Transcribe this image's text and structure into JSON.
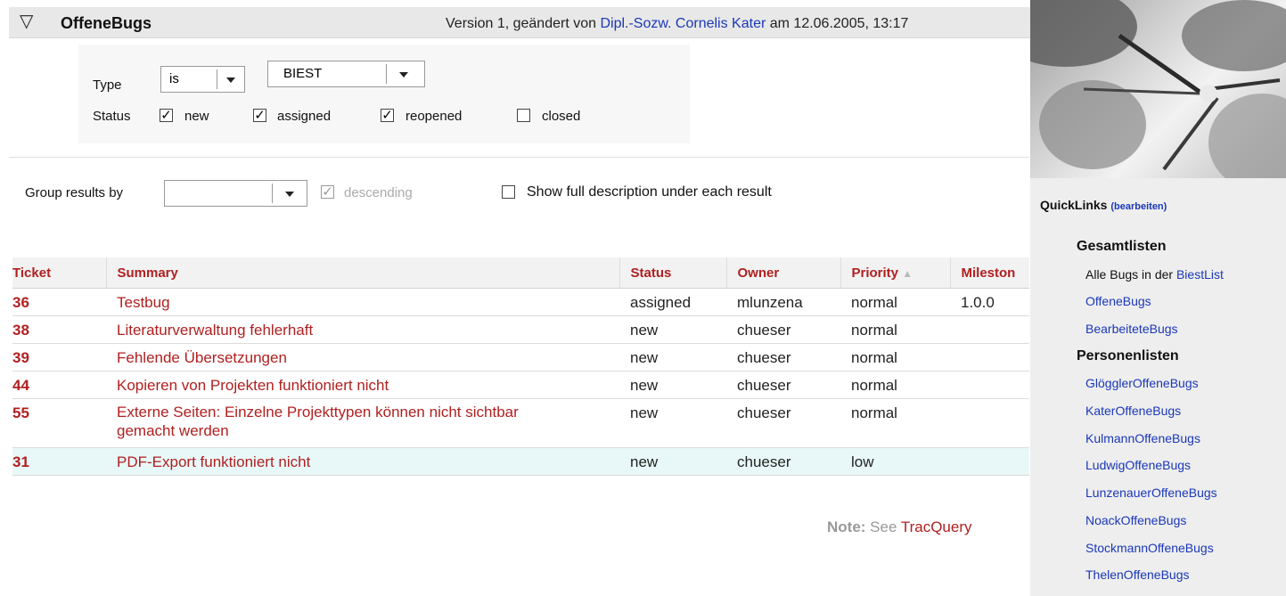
{
  "header": {
    "toggle_icon": "triangle-down",
    "title": "OffeneBugs",
    "version_prefix": "Version 1, geändert von ",
    "version_author": "Dipl.-Sozw. Cornelis Kater",
    "version_suffix": " am 12.06.2005, 13:17"
  },
  "filters": {
    "type_label": "Type",
    "type_operator": "is",
    "type_value": "BIEST",
    "status_label": "Status",
    "status_options": [
      {
        "label": "new",
        "checked": true
      },
      {
        "label": "assigned",
        "checked": true
      },
      {
        "label": "reopened",
        "checked": true
      },
      {
        "label": "closed",
        "checked": false
      }
    ]
  },
  "group": {
    "label": "Group results by",
    "value": "",
    "descending_label": "descending",
    "show_desc_label": "Show full description under each result"
  },
  "table": {
    "columns": [
      "Ticket",
      "Summary",
      "Status",
      "Owner",
      "Priority",
      "Mileston"
    ],
    "sort_indicator": "▲",
    "rows": [
      {
        "id": "36",
        "summary": "Testbug",
        "status": "assigned",
        "owner": "mlunzena",
        "priority": "normal",
        "milestone": "1.0.0"
      },
      {
        "id": "38",
        "summary": "Literaturverwaltung fehlerhaft",
        "status": "new",
        "owner": "chueser",
        "priority": "normal",
        "milestone": ""
      },
      {
        "id": "39",
        "summary": "Fehlende Übersetzungen",
        "status": "new",
        "owner": "chueser",
        "priority": "normal",
        "milestone": ""
      },
      {
        "id": "44",
        "summary": "Kopieren von Projekten funktioniert nicht",
        "status": "new",
        "owner": "chueser",
        "priority": "normal",
        "milestone": ""
      },
      {
        "id": "55",
        "summary": "Externe Seiten: Einzelne Projekttypen können nicht sichtbar gemacht werden",
        "status": "new",
        "owner": "chueser",
        "priority": "normal",
        "milestone": ""
      },
      {
        "id": "31",
        "summary": "PDF-Export funktioniert nicht",
        "status": "new",
        "owner": "chueser",
        "priority": "low",
        "milestone": ""
      }
    ]
  },
  "note": {
    "prefix": "Note:",
    "text": " See ",
    "link": "TracQuery"
  },
  "sidebar": {
    "quicklinks_label": "QuickLinks",
    "edit_label": "(bearbeiten)",
    "section1": "Gesamtlisten",
    "alle_text": "Alle Bugs in der ",
    "alle_link": "BiestList",
    "section1_items": [
      "OffeneBugs",
      "BearbeiteteBugs"
    ],
    "section2": "Personenlisten",
    "section2_items": [
      "GlögglerOffeneBugs",
      "KaterOffeneBugs",
      "KulmannOffeneBugs",
      "LudwigOffeneBugs",
      "LunzenauerOffeneBugs",
      "NoackOffeneBugs",
      "StockmannOffeneBugs",
      "ThelenOffeneBugs"
    ]
  },
  "colors": {
    "ticket_red": "#b02020",
    "link_blue": "#1a38b8",
    "highlight_row": "#e8f8f8"
  }
}
